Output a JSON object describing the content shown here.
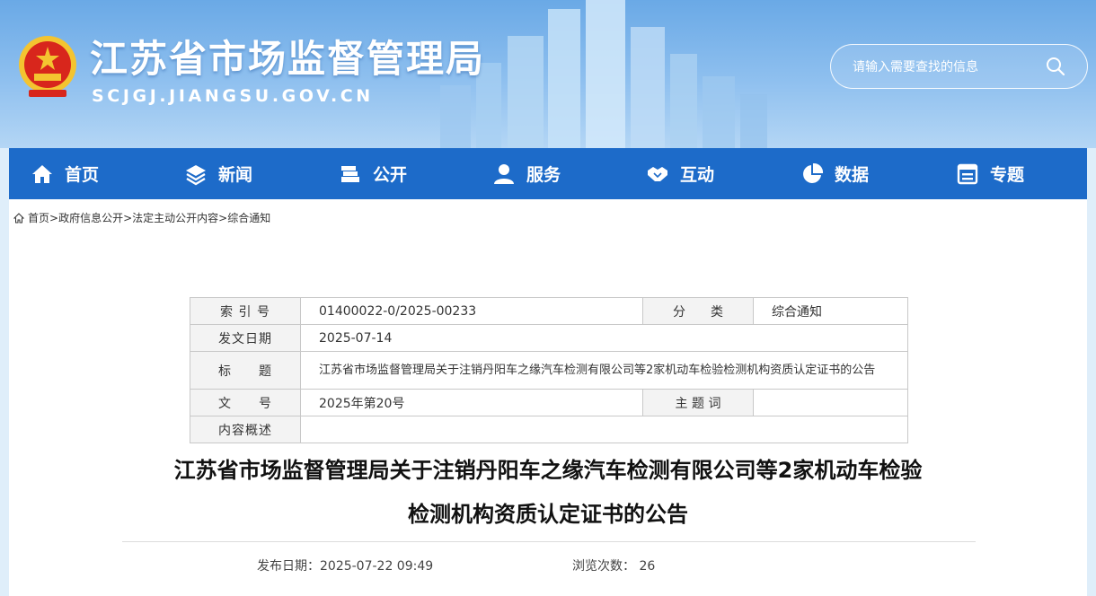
{
  "header": {
    "site_title": "江苏省市场监督管理局",
    "site_domain": "SCJGJ.JIANGSU.GOV.CN",
    "search_placeholder": "请输入需要查找的信息"
  },
  "nav": {
    "items": [
      {
        "label": "首页",
        "icon": "home-icon"
      },
      {
        "label": "新闻",
        "icon": "layers-icon"
      },
      {
        "label": "公开",
        "icon": "documents-icon"
      },
      {
        "label": "服务",
        "icon": "user-icon"
      },
      {
        "label": "互动",
        "icon": "handshake-icon"
      },
      {
        "label": "数据",
        "icon": "pie-chart-icon"
      },
      {
        "label": "专题",
        "icon": "window-icon"
      }
    ]
  },
  "breadcrumb": {
    "items": [
      "首页",
      "政府信息公开",
      "法定主动公开内容",
      "综合通知"
    ],
    "separator": ">"
  },
  "meta": {
    "index_label": "索 引 号",
    "index_value": "01400022-0/2025-00233",
    "category_label": "分　　类",
    "category_value": "综合通知",
    "date_label": "发文日期",
    "date_value": "2025-07-14",
    "title_label": "标　　题",
    "title_value": "江苏省市场监督管理局关于注销丹阳车之缘汽车检测有限公司等2家机动车检验检测机构资质认定证书的公告",
    "docno_label": "文　　号",
    "docno_value": "2025年第20号",
    "keyword_label": "主 题 词",
    "keyword_value": "",
    "summary_label": "内容概述",
    "summary_value": ""
  },
  "article": {
    "title_line1": "江苏省市场监督管理局关于注销丹阳车之缘汽车检测有限公司等2家机动车检验",
    "title_line2": "检测机构资质认定证书的公告",
    "pubdate": "发布日期：2025-07-22 09:49",
    "views": "浏览次数： 26"
  }
}
